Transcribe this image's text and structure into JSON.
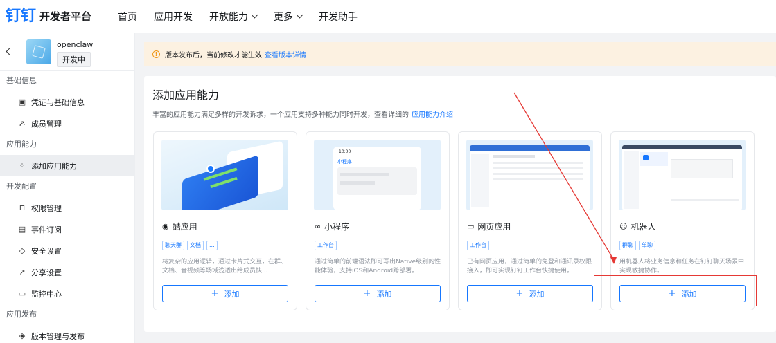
{
  "topbar": {
    "logo_mark": "钉钉",
    "logo_text": "开发者平台",
    "nav": [
      {
        "label": "首页",
        "dropdown": false
      },
      {
        "label": "应用开发",
        "dropdown": false
      },
      {
        "label": "开放能力",
        "dropdown": true
      },
      {
        "label": "更多",
        "dropdown": true
      },
      {
        "label": "开发助手",
        "dropdown": false
      }
    ]
  },
  "app": {
    "name": "openclaw",
    "status": "开发中"
  },
  "sidebar": {
    "sections": [
      {
        "title": "基础信息",
        "items": [
          {
            "label": "凭证与基础信息",
            "icon": "credential-icon",
            "active": false
          },
          {
            "label": "成员管理",
            "icon": "member-icon",
            "active": false
          }
        ]
      },
      {
        "title": "应用能力",
        "items": [
          {
            "label": "添加应用能力",
            "icon": "capability-icon",
            "active": true
          }
        ]
      },
      {
        "title": "开发配置",
        "items": [
          {
            "label": "权限管理",
            "icon": "lock-icon",
            "active": false
          },
          {
            "label": "事件订阅",
            "icon": "event-icon",
            "active": false
          },
          {
            "label": "安全设置",
            "icon": "shield-icon",
            "active": false
          },
          {
            "label": "分享设置",
            "icon": "share-icon",
            "active": false
          },
          {
            "label": "监控中心",
            "icon": "monitor-icon",
            "active": false
          }
        ]
      },
      {
        "title": "应用发布",
        "items": [
          {
            "label": "版本管理与发布",
            "icon": "version-icon",
            "active": false
          }
        ]
      }
    ]
  },
  "notice": {
    "text": "版本发布后，当前修改才能生效",
    "link": "查看版本详情"
  },
  "panel": {
    "title": "添加应用能力",
    "desc": "丰富的应用能力满足多样的开发诉求，一个应用支持多种能力同时开发，查看详细的",
    "desc_link": "应用能力介绍"
  },
  "cards": [
    {
      "name": "酷应用",
      "icon": "cool-app-icon",
      "tags": [
        "聊天群",
        "文档",
        "..."
      ],
      "desc": "将复杂的应用逻辑，通过卡片式交互，在群、文档、音视频等场域浅透出给成员快...",
      "button": "添加"
    },
    {
      "name": "小程序",
      "icon": "mini-program-icon",
      "tags": [
        "工作台"
      ],
      "desc": "通过简单的前端语法即可写出Native级别的性能体验，支持iOS和Android跨部署。",
      "button": "添加",
      "preview_time": "10:00",
      "preview_title": "小程序"
    },
    {
      "name": "网页应用",
      "icon": "web-app-icon",
      "tags": [
        "工作台"
      ],
      "desc": "已有网页应用，通过简单的免登和通讯录权限接入，即可实现钉钉工作台快捷使用。",
      "button": "添加"
    },
    {
      "name": "机器人",
      "icon": "robot-icon",
      "tags": [
        "群聊",
        "单聊"
      ],
      "desc": "用机器人将业务信息和任务在钉钉聊天场景中实现敏捷协作。",
      "button": "添加"
    }
  ],
  "colors": {
    "accent": "#1677ff",
    "annotation": "#e53935",
    "notice_bg": "#fcf1e1"
  }
}
